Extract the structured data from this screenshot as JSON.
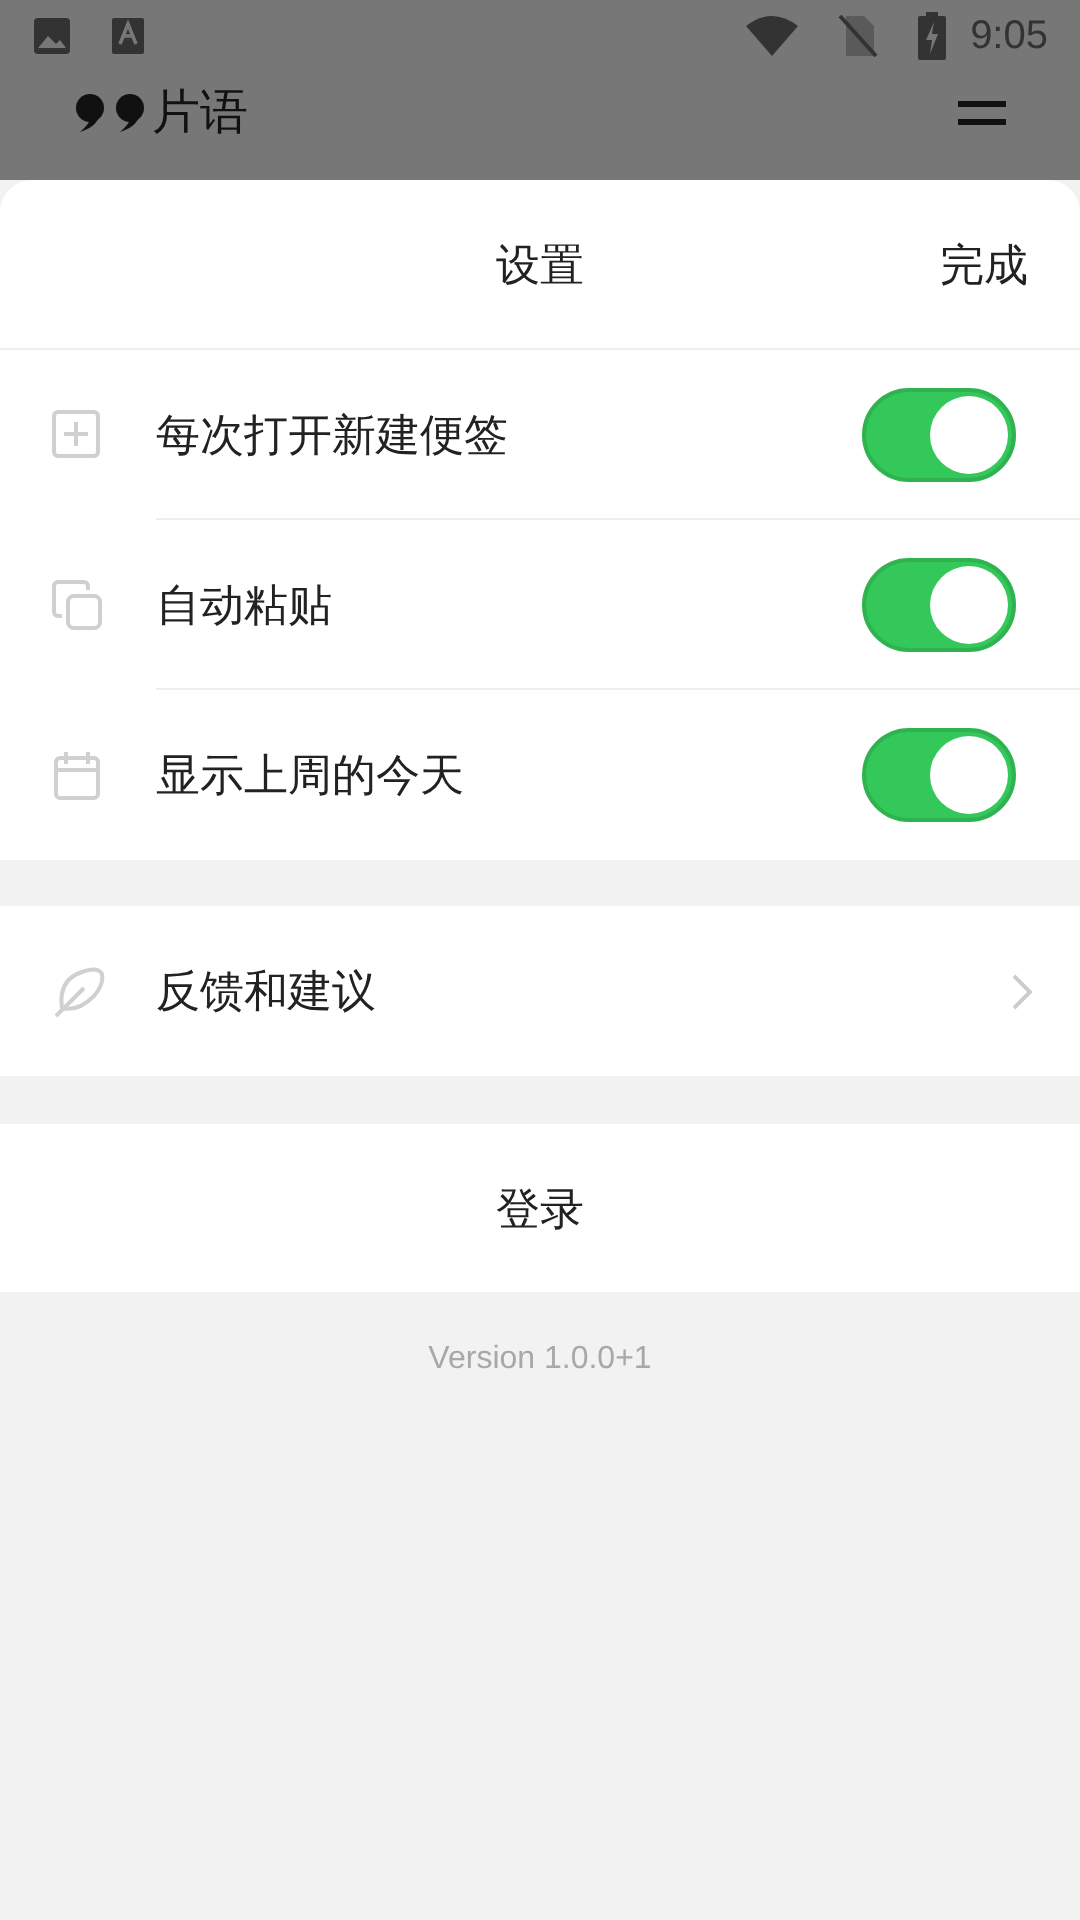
{
  "status_bar": {
    "time": "9:05"
  },
  "app_header": {
    "title": "片语"
  },
  "sheet": {
    "title": "设置",
    "done": "完成"
  },
  "toggles": [
    {
      "label": "每次打开新建便签",
      "on": true
    },
    {
      "label": "自动粘贴",
      "on": true
    },
    {
      "label": "显示上周的今天",
      "on": true
    }
  ],
  "links": [
    {
      "label": "反馈和建议"
    }
  ],
  "login_button": "登录",
  "version": "Version 1.0.0+1"
}
